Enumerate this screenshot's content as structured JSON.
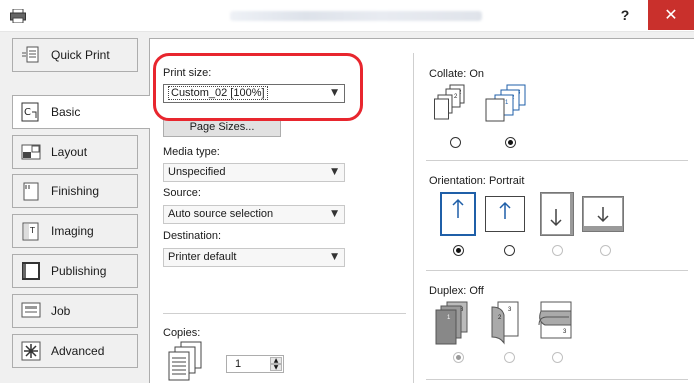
{
  "window": {
    "help_label": "?",
    "close_label": "✕"
  },
  "tabs": [
    {
      "label": "Quick Print",
      "icon": "quick-print-icon"
    },
    {
      "label": "Basic",
      "icon": "basic-icon"
    },
    {
      "label": "Layout",
      "icon": "layout-icon"
    },
    {
      "label": "Finishing",
      "icon": "finishing-icon"
    },
    {
      "label": "Imaging",
      "icon": "imaging-icon"
    },
    {
      "label": "Publishing",
      "icon": "publishing-icon"
    },
    {
      "label": "Job",
      "icon": "job-icon"
    },
    {
      "label": "Advanced",
      "icon": "advanced-icon"
    }
  ],
  "basic": {
    "print_size_label": "Print size:",
    "print_size_value": "Custom_02 [100%]",
    "page_sizes_button": "Page Sizes...",
    "media_type_label": "Media type:",
    "media_type_value": "Unspecified",
    "source_label": "Source:",
    "source_value": "Auto source selection",
    "destination_label": "Destination:",
    "destination_value": "Printer default",
    "copies_label": "Copies:",
    "copies_value": "1"
  },
  "collate": {
    "label": "Collate:",
    "value": "On"
  },
  "orientation": {
    "label": "Orientation:",
    "value": "Portrait"
  },
  "duplex": {
    "label": "Duplex:",
    "value": "Off"
  },
  "colors": {
    "accent": "#1f5fa8",
    "highlight_ring": "#e8262e",
    "close": "#c9302c"
  }
}
